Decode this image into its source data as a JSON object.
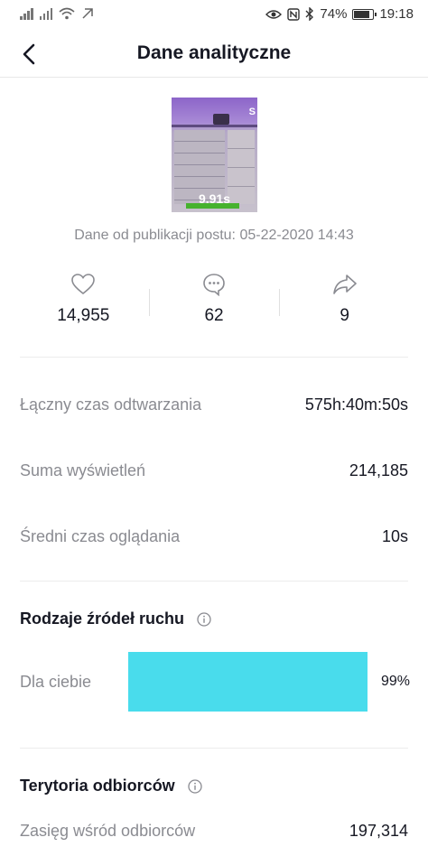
{
  "status_bar": {
    "battery": "74%",
    "time": "19:18"
  },
  "header": {
    "title": "Dane analityczne"
  },
  "video": {
    "duration": "9.91s",
    "published": "Dane od publikacji postu: 05-22-2020 14:43"
  },
  "engagement": {
    "likes": "14,955",
    "comments": "62",
    "shares": "9"
  },
  "metrics": [
    {
      "label": "Łączny czas odtwarzania",
      "value": "575h:40m:50s"
    },
    {
      "label": "Suma wyświetleń",
      "value": "214,185"
    },
    {
      "label": "Średni czas oglądania",
      "value": "10s"
    }
  ],
  "traffic_sources": {
    "title": "Rodzaje źródeł ruchu",
    "items": [
      {
        "label": "Dla ciebie",
        "percent_text": "99%",
        "percent": 99,
        "color": "#49dcec"
      }
    ]
  },
  "audience": {
    "title": "Terytoria odbiorców",
    "reach_label": "Zasięg wśród odbiorców",
    "reach_value": "197,314"
  }
}
